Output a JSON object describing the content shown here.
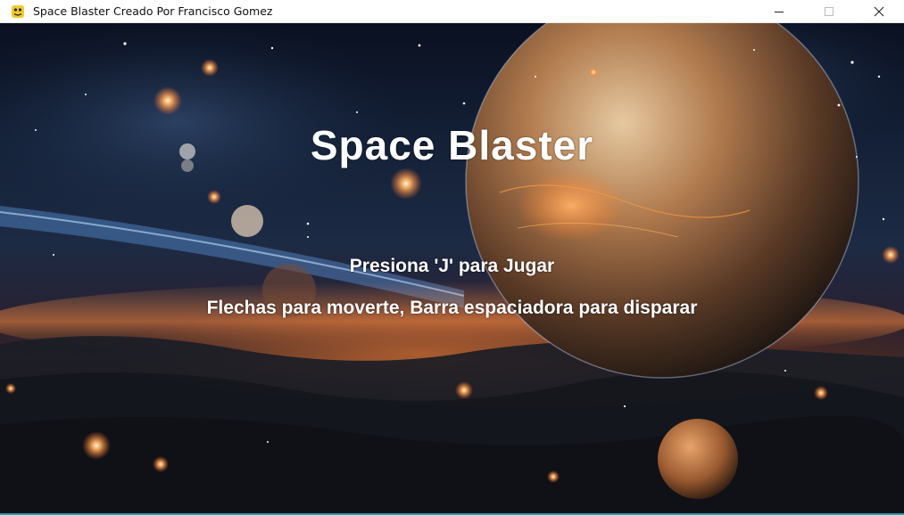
{
  "window": {
    "title": "Space Blaster Creado Por Francisco Gomez",
    "icons": {
      "app": "python-snake-icon",
      "minimize": "minimize-icon",
      "maximize": "maximize-icon",
      "close": "close-icon"
    }
  },
  "game": {
    "title": "Space Blaster",
    "prompt": "Presiona 'J' para Jugar",
    "instructions": "Flechas para moverte, Barra espaciadora para disparar"
  },
  "colors": {
    "text": "#ffffff",
    "titlebar": "#ffffff",
    "planet_main": "#b07a4e",
    "glow": "#ff8a3c"
  }
}
